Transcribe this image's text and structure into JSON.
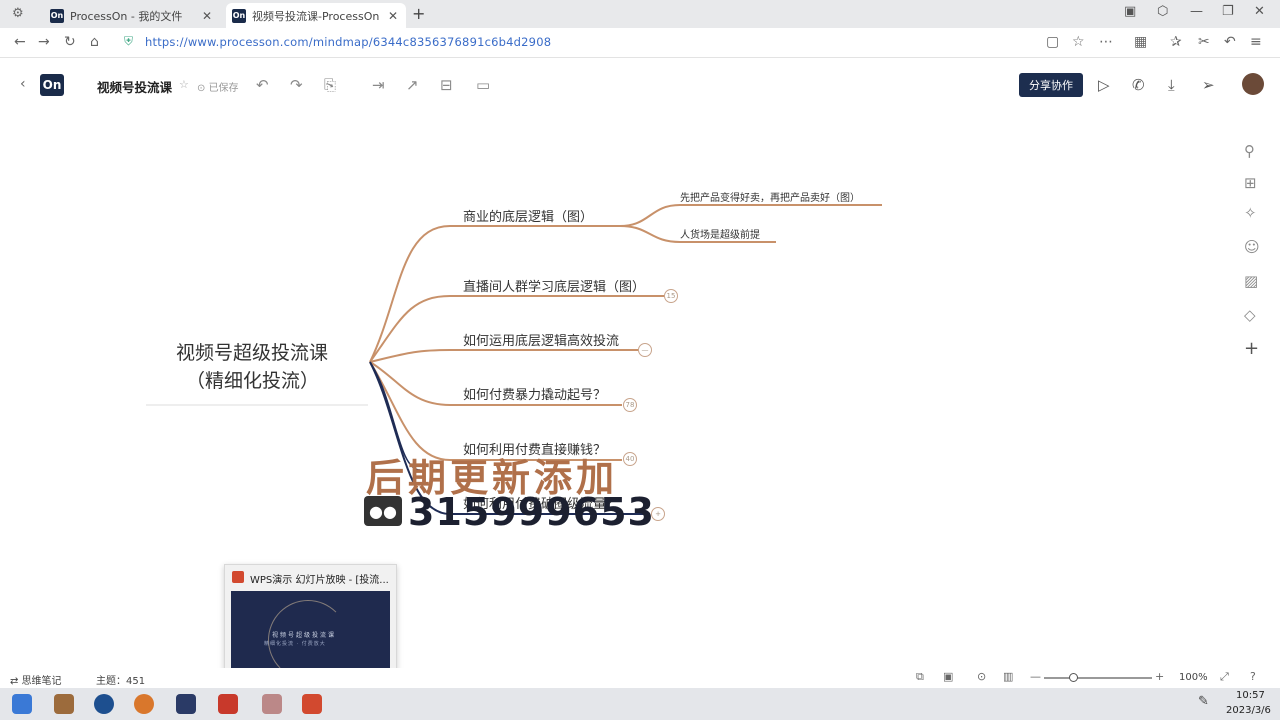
{
  "browser": {
    "tabs": [
      {
        "favicon": "On",
        "label": "ProcessOn - 我的文件"
      },
      {
        "favicon": "On",
        "label": "视频号投流课-ProcessOn"
      }
    ],
    "url": "https://www.processon.com/mindmap/6344c8356376891c6b4d2908"
  },
  "app": {
    "logo": "On",
    "title": "视频号投流课",
    "saved_status": "已保存",
    "share_label": "分享协作"
  },
  "mindmap": {
    "root_line1": "视频号超级投流课",
    "root_line2": "（精细化投流）",
    "branches": [
      {
        "label": "商业的底层逻辑（图）",
        "badge": ""
      },
      {
        "label": "直播间人群学习底层逻辑（图）",
        "badge": "15"
      },
      {
        "label": "如何运用底层逻辑高效投流",
        "badge": "—"
      },
      {
        "label": "如何付费暴力撬动起号？",
        "badge": "78"
      },
      {
        "label": "如何利用付费直接赚钱？",
        "badge": "40"
      },
      {
        "label": "如何利用付费破圈级流量？",
        "badge": "+"
      }
    ],
    "sub_branches": [
      "先把产品变得好卖，再把产品卖好（图）",
      "人货场是超级前提"
    ]
  },
  "overlay": {
    "headline": "后期更新添加",
    "contact_number": "315999653"
  },
  "popup": {
    "title": "WPS演示 幻灯片放映 - [投流...",
    "thumb_line1": "视频号超级投流课",
    "thumb_line2": "精细化投流 · 付费放大"
  },
  "statusbar": {
    "notes_label": "思维笔记",
    "topics_label": "主题：451",
    "zoom": "100%"
  },
  "taskbar": {
    "time": "10:57",
    "date": "2023/3/6"
  },
  "colors": {
    "branch_line": "#c8916a",
    "accent_dark": "#1d2e4f"
  }
}
